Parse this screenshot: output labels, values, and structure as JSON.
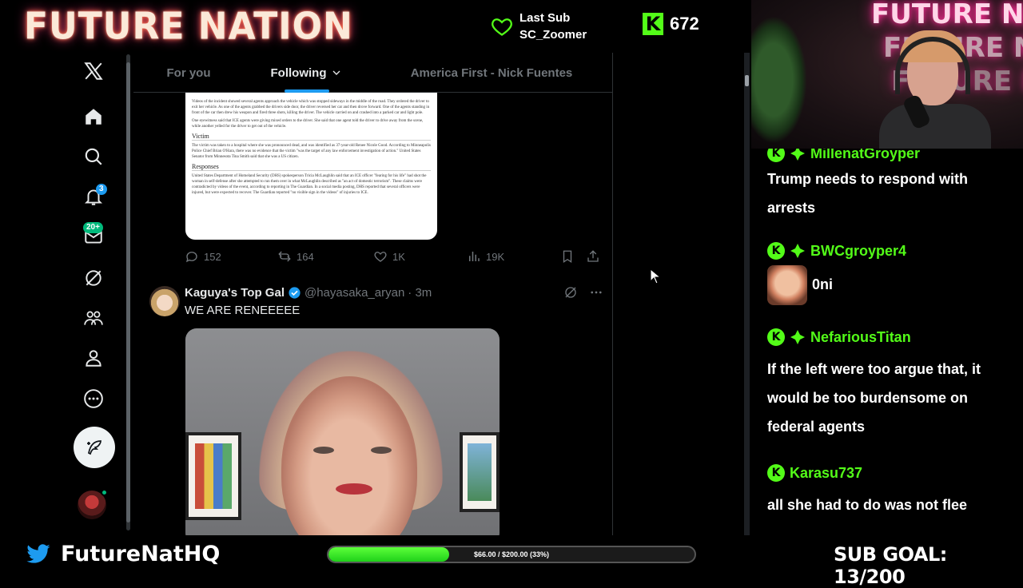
{
  "stream": {
    "brand": "FUTURE NATION",
    "last_sub_label": "Last Sub",
    "last_sub_user": "SC_Zoomer",
    "kick_letter": "K",
    "kick_count": "672",
    "camera_neon": "FUTURE NATION"
  },
  "nav": {
    "notifications_badge": "3",
    "messages_badge": "20+"
  },
  "timeline": {
    "tabs": [
      "For you",
      "Following",
      "America First - Nick Fuentes"
    ],
    "active_tab": "Following",
    "quoted_card": {
      "para1": "Videos of the incident showed several agents approach the vehicle which was stopped sideways in the middle of the road. They ordered the driver to exit her vehicle. As one of the agents grabbed the drivers side door, the driver reversed her car and then drove forward. One of the agents standing in front of the car then drew his weapon and fired three shots, killing the driver. The vehicle carried on and crashed into a parked car and light pole.",
      "para2": "One eyewitness said that ICE agents were giving mixed orders to the driver. She said that one agent told the driver to drive away from the scene, while another yelled for the driver to get out of the vehicle.",
      "heading_victim": "Victim",
      "para3": "The victim was taken to a hospital where she was pronounced dead, and was identified as 37-year-old Renee Nicole Good. According to Minneapolis Police Chief Brian O'Hara, there was no evidence that the victim \"was the target of any law enforcement investigation of action.\" United States Senator from Minnesota Tina Smith said that she was a US citizen.",
      "heading_responses": "Responses",
      "para4": "United States Department of Homeland Security (DHS) spokesperson Tricia McLaughlin said that an ICE officer \"fearing for his life\" had shot the woman in self-defense after she attempted to run them over in what McLaughlin described as \"an act of domestic terrorism\". These claims were contradicted by videos of the event, according to reporting in The Guardian. In a social media posting, DHS reported that several officers were injured, but were expected to recover. The Guardian reported \"no visible sign in the videos\" of injuries to ICE."
    },
    "actions": {
      "replies": "152",
      "reposts": "164",
      "likes": "1K",
      "views": "19K"
    },
    "tweet2": {
      "name": "Kaguya's Top Gal",
      "handle": "@hayasaka_aryan",
      "time": "· 3m",
      "text": "WE ARE RENEEEEE"
    }
  },
  "chat": [
    {
      "user": "MillenatGroyper",
      "message": "Trump needs to respond with arrests"
    },
    {
      "user": "BWCgroyper4",
      "message": "0ni",
      "emote": true
    },
    {
      "user": "NefariousTitan",
      "message": "If the left were too argue that, it would be too burdensome on federal agents"
    },
    {
      "user": "Karasu737",
      "message": "all she had to do was not flee"
    }
  ],
  "bottom": {
    "twitter_handle": "FutureNatHQ",
    "goal_text": "$66.00 / $200.00 (33%)",
    "goal_fraction": 0.33,
    "sub_goal": "SUB GOAL: 13/200"
  },
  "colors": {
    "kick_green": "#53fc18",
    "x_blue": "#1d9bf0",
    "bg": "#000000"
  }
}
